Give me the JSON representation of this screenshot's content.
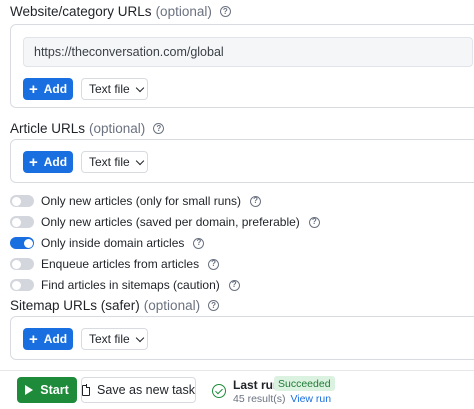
{
  "website_section": {
    "label": "Website/category URLs",
    "optional": "(optional)",
    "url_value": "https://theconversation.com/global",
    "add_label": "Add",
    "select_value": "Text file"
  },
  "article_section": {
    "label": "Article URLs",
    "optional": "(optional)",
    "add_label": "Add",
    "select_value": "Text file"
  },
  "toggles": [
    {
      "label": "Only new articles (only for small runs)",
      "on": false
    },
    {
      "label": "Only new articles (saved per domain, preferable)",
      "on": false
    },
    {
      "label": "Only inside domain articles",
      "on": true
    },
    {
      "label": "Enqueue articles from articles",
      "on": false
    },
    {
      "label": "Find articles in sitemaps (caution)",
      "on": false
    }
  ],
  "sitemap_section": {
    "label": "Sitemap URLs (safer)",
    "optional": "(optional)",
    "add_label": "Add",
    "select_value": "Text file"
  },
  "bottom": {
    "start_label": "Start",
    "save_label": "Save as new task",
    "last_run_label": "Last run",
    "status_badge": "Succeeded",
    "results_text": "45 result(s)",
    "view_run_label": "View run"
  },
  "colors": {
    "primary": "#1a6fe0",
    "success": "#1e8b3a",
    "badge_bg": "#dcf2e1"
  },
  "icons": {
    "help": "question-circle-icon",
    "add": "plus-icon",
    "select": "chevron-down-icon",
    "start": "play-icon",
    "save": "document-icon",
    "status": "check-circle-icon"
  }
}
